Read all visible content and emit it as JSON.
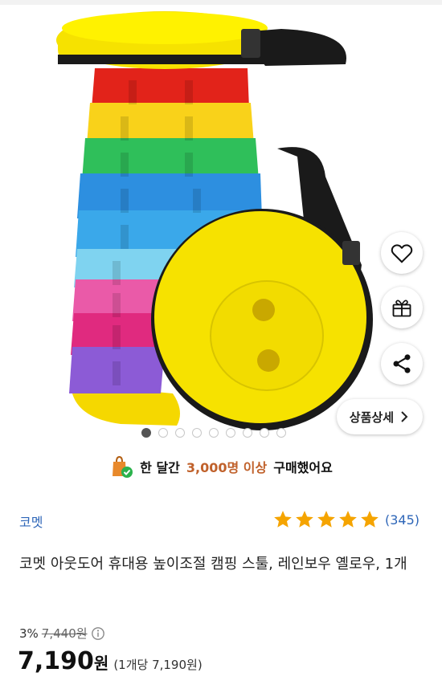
{
  "product": {
    "image_alt": "rainbow collapsible camping stool",
    "image_count": 9,
    "active_image": 1
  },
  "actions": {
    "wishlist_icon": "heart-icon",
    "gift_icon": "gift-icon",
    "share_icon": "share-icon",
    "detail_label": "상품상세"
  },
  "social_proof": {
    "prefix": "한 달간",
    "highlight": "3,000명 이상",
    "suffix": "구매했어요"
  },
  "brand": "코멧",
  "rating": {
    "stars": 5,
    "count": "(345)"
  },
  "title": "코멧 아웃도어 휴대용 높이조절 캠핑 스툴, 레인보우 옐로우, 1개",
  "price": {
    "discount": "3%",
    "original": "7,440원",
    "current": "7,190",
    "currency": "원",
    "unit_price": "(1개당 7,190원)"
  },
  "colors": {
    "accent_link": "#2e66b8",
    "star": "#f5a400",
    "highlight": "#c0612b"
  }
}
